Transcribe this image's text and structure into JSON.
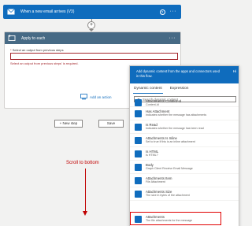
{
  "trigger": {
    "title": "When a new email arrives (V3)",
    "help": "?",
    "more": "···"
  },
  "connector": {
    "plus": "+"
  },
  "apply_to_each": {
    "title": "Apply to each",
    "more": "···",
    "field_label": "Select an output from previous steps",
    "required_mark": "*",
    "error": "Select an output from previous steps' is required.",
    "add_action": "Add an action"
  },
  "buttons": {
    "new_step": "+ New step",
    "save": "Save"
  },
  "annotation": {
    "text": "Scroll to bottom"
  },
  "panel": {
    "header": "Add dynamic content from the apps and connectors used in this flow.",
    "hide": "Hi",
    "tabs": [
      "Dynamic content",
      "Expression"
    ],
    "search_placeholder": "Search dynamic content",
    "items": [
      {
        "name": "Attachments Content-Id",
        "desc": "Content-Id"
      },
      {
        "name": "Has Attachment",
        "desc": "Indicates whether the message has attachments"
      },
      {
        "name": "Is Read",
        "desc": "Indicates whether the message has been read"
      },
      {
        "name": "Attachments Is Inline",
        "desc": "Set to true if this is an inline attachment"
      },
      {
        "name": "Is HTML",
        "desc": "Is HTML?"
      },
      {
        "name": "Body",
        "desc": "Graph Client Receive Email Message"
      },
      {
        "name": "Attachments Item",
        "desc": "File Attachment"
      },
      {
        "name": "Attachments Size",
        "desc": "The size in bytes of the attachment"
      },
      {
        "name": "Attachments",
        "desc": "The file attachments for the message"
      }
    ]
  },
  "colors": {
    "brand": "#0f6cbd",
    "apply_header": "#476a85",
    "error": "#a4262c",
    "annotation": "#c00000"
  }
}
